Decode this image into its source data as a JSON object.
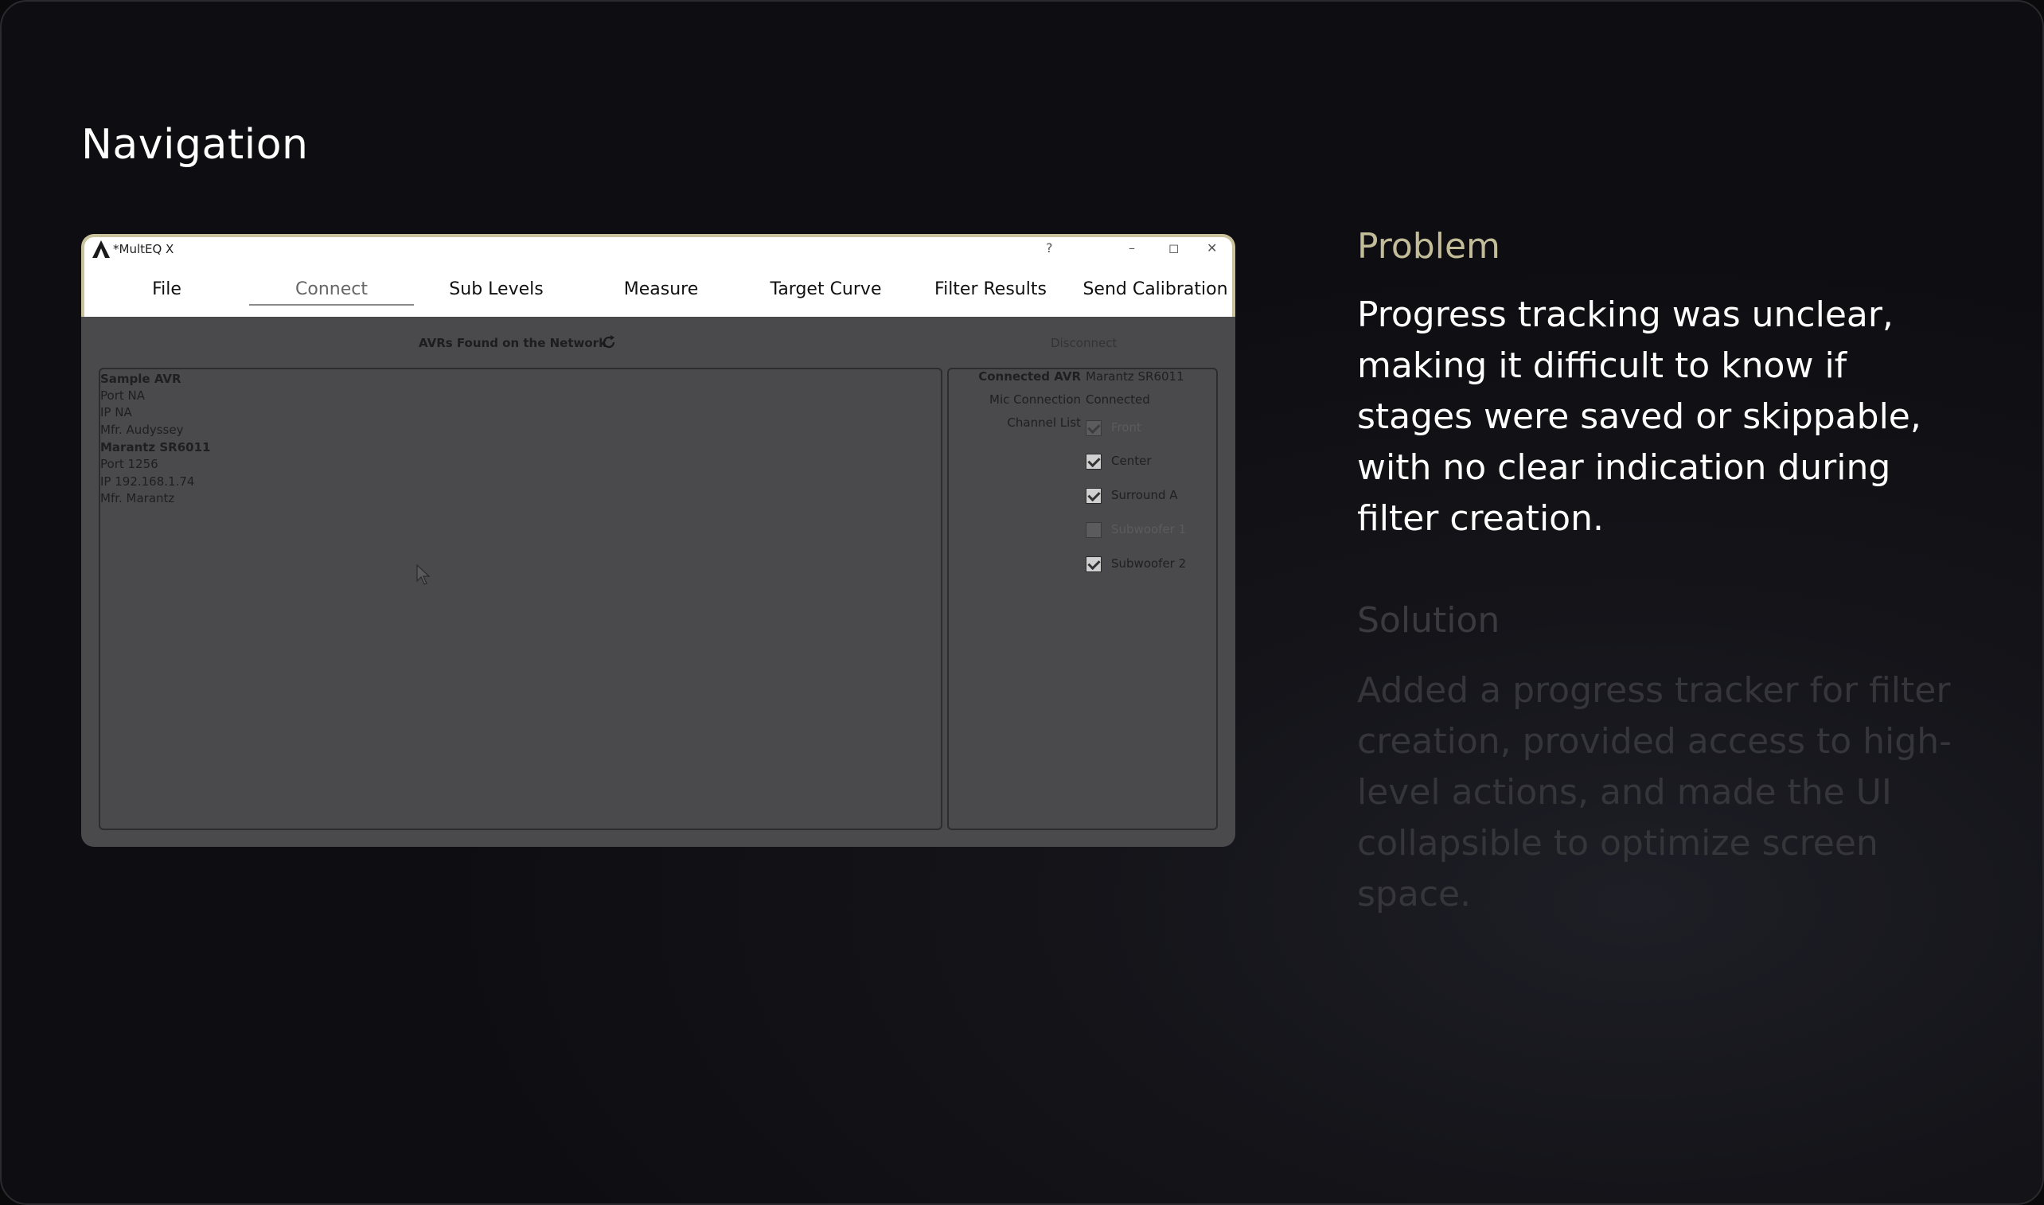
{
  "section_title": "Navigation",
  "app": {
    "title": "*MultEQ X",
    "window_controls": {
      "help": "?",
      "minimize": "–",
      "restore": "◻",
      "close": "✕"
    },
    "nav": [
      "File",
      "Connect",
      "Sub Levels",
      "Measure",
      "Target Curve",
      "Filter Results",
      "Send Calibration"
    ],
    "active_nav": "Connect",
    "avr_header": "AVRs Found on the Network",
    "disconnect_label": "Disconnect",
    "avr_list": [
      "Sample AVR",
      "Port  NA",
      "IP     NA",
      "Mfr.  Audyssey",
      "Marantz SR6011",
      "Port  1256",
      "IP     192.168.1.74",
      "Mfr.  Marantz"
    ],
    "details": {
      "connected_avr_label": "Connected AVR",
      "connected_avr_value": "Marantz SR6011",
      "mic_connection_label": "Mic Connection",
      "mic_connection_value": "Connected",
      "channel_list_label": "Channel List"
    },
    "channels": [
      {
        "label": "Front",
        "checked": true,
        "disabled": true
      },
      {
        "label": "Center",
        "checked": true,
        "disabled": false
      },
      {
        "label": "Surround A",
        "checked": true,
        "disabled": false
      },
      {
        "label": "Subwoofer 1",
        "checked": false,
        "disabled": true
      },
      {
        "label": "Subwoofer 2",
        "checked": true,
        "disabled": false
      }
    ]
  },
  "problem": {
    "title": "Problem",
    "body": "Progress tracking was unclear, making it difficult to know if stages were saved or skippable, with no clear indication during filter creation."
  },
  "solution": {
    "title": "Solution",
    "body": "Added a progress tracker for filter creation, provided access to high-level actions, and made the UI collapsible to optimize screen space."
  },
  "colors": {
    "accent": "#c2bc98",
    "window_border": "#c9c29a",
    "overlay": "#4a4a4d"
  }
}
